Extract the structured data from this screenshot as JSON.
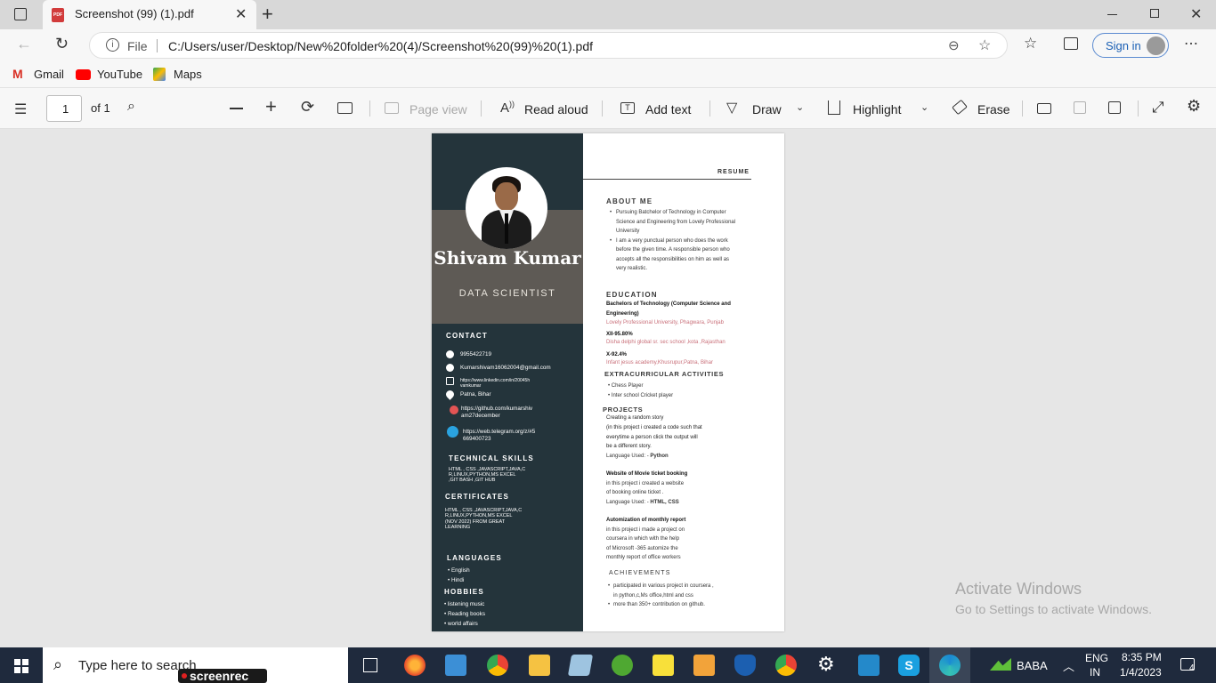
{
  "browser": {
    "tab_title": "Screenshot (99) (1).pdf",
    "address_label": "File",
    "url": "C:/Users/user/Desktop/New%20folder%20(4)/Screenshot%20(99)%20(1).pdf",
    "sign_in": "Sign in",
    "favorites": [
      "Gmail",
      "YouTube",
      "Maps"
    ]
  },
  "pdf_toolbar": {
    "page_number": "1",
    "page_total": "of 1",
    "page_view": "Page view",
    "read_aloud": "Read aloud",
    "add_text": "Add text",
    "draw": "Draw",
    "highlight": "Highlight",
    "erase": "Erase"
  },
  "resume": {
    "name": "Shivam Kumar",
    "role": "DATA SCIENTIST",
    "header_label": "RESUME",
    "contact_heading": "CONTACT",
    "contact": {
      "phone": "9955422719",
      "email": "Kumarshivam16062004@gmail.com",
      "linkedin_1": "https://www.linkedin.com/in/20045h",
      "linkedin_2": "vamkumar",
      "location": "Patna, Bihar",
      "github_1": "https://github.com/kumarshiv",
      "github_2": "am27december",
      "telegram_1": "https://web.telegram.org/z/#5",
      "telegram_2": "669400723"
    },
    "tech_heading": "TECHNICAL SKILLS",
    "tech_lines": [
      "HTML , CSS ,JAVASCRIPT,JAVA,C",
      "R,LINUX,PYTHON,MS EXCEL",
      ",GIT BASH ,GIT HUB"
    ],
    "cert_heading": "CERTIFICATES",
    "cert_lines": [
      "HTML , CSS ,JAVASCRIPT,JAVA,C",
      "R,LINUX,PYTHON,MS EXCEL",
      "(NOV 2022)  FROM GREAT",
      "LEARNING"
    ],
    "lang_heading": "LANGUAGES",
    "languages": [
      "English",
      "Hindi"
    ],
    "hobbies_heading": "HOBBIES",
    "hobbies": [
      "listening music",
      "Reading books",
      "world affairs"
    ],
    "about_heading": "ABOUT ME",
    "about_1": [
      "Pursuing Batchelor of Technology in Computer",
      "Science and Engineering from Lovely Professional",
      "University"
    ],
    "about_2": [
      "I am a very punctual person who does the work",
      "before the given time. A responsible person who",
      "accepts all the responsibilities on him as well as",
      "very realistic."
    ],
    "edu_heading": "EDUCATION",
    "edu_degree_1": "Bachelors of Technology (Computer Science and",
    "edu_degree_2": "Engineering)",
    "edu_school_1": "Lovely Professional University, Phagwara, Punjab",
    "edu_xii": "XII-95.80%",
    "edu_school_2": "Disha delphi global sr. sec school ,kota ,Rajasthan",
    "edu_x": "X-92.4%",
    "edu_school_3": "Infant jesus academy,Khusrupur,Patna, Bihar",
    "extra_heading": "EXTRACURRICULAR ACTIVITIES",
    "extra": [
      "Chess Player",
      "Inter school Cricket player"
    ],
    "projects_heading": "PROJECTS",
    "p1": [
      "Creating a random story",
      "(in this project i created a code such that",
      "everytime a person click the output will",
      "be a different story."
    ],
    "p1_lang_label": "Language Used: -",
    "p1_lang": "Python",
    "p2_title": "Website of Movie ticket booking",
    "p2": [
      "in this project i created a website",
      "of booking online ticket ."
    ],
    "p2_lang_label": "Language Used: -",
    "p2_lang": "HTML, CSS",
    "p3_title": "Automization of monthly report",
    "p3": [
      "in this project i made a project on",
      "coursera in which with the help",
      "of Microsoft -365 automize the",
      "monthly report of office workers"
    ],
    "ach_heading": "ACHIEVEMENTS",
    "ach_1a": "participated in various project in coursera ,",
    "ach_1b": "in python,c,Ms office,html and css",
    "ach_2": "more than 350+ contribution on github."
  },
  "watermark": {
    "line1": "Activate Windows",
    "line2": "Go to Settings to activate Windows."
  },
  "taskbar": {
    "search_placeholder": "Type here to search",
    "screenrec": "screenrec",
    "user": "BABA",
    "lang_1": "ENG",
    "lang_2": "IN",
    "time": "8:35 PM",
    "date": "1/4/2023",
    "notifications": "4"
  },
  "colors": {
    "sidebar": "#24343b",
    "band": "#5e5a55",
    "accent_red": "#c9707a"
  }
}
